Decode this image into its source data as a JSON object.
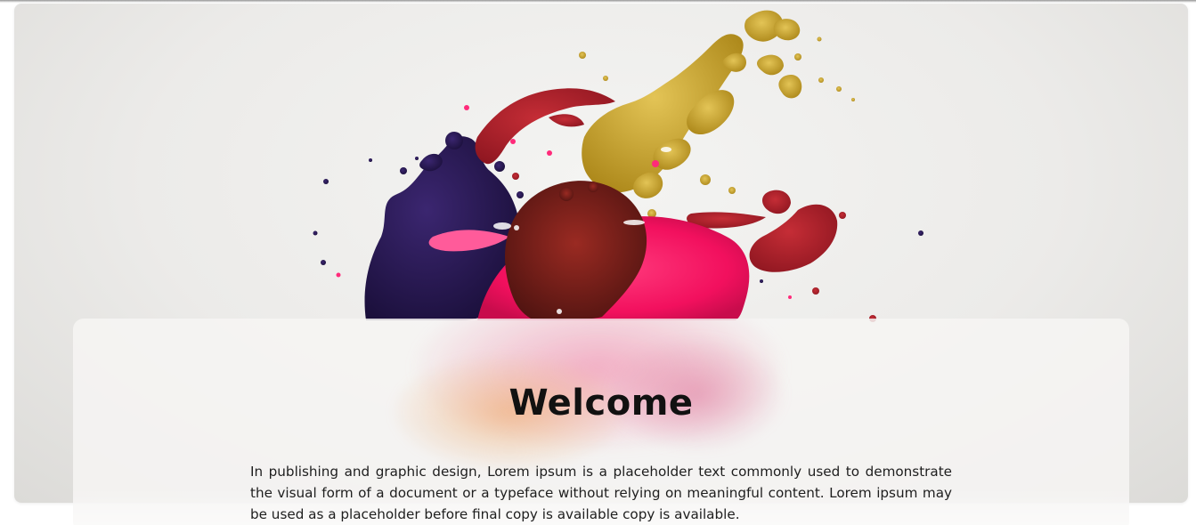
{
  "hero": {
    "image_icon": "paint-splash-image",
    "colors": {
      "background": "#ecebe9",
      "navy": "#2b1a55",
      "crimson": "#b3182b",
      "magenta": "#ff1f6a",
      "gold": "#c9a227"
    }
  },
  "card": {
    "title": "Welcome",
    "body": "In publishing and graphic design, Lorem ipsum is a placeholder text commonly used to demonstrate the visual form of a document or a typeface without relying on meaningful content. Lorem ipsum may be used as a placeholder before final copy is available copy is available."
  }
}
